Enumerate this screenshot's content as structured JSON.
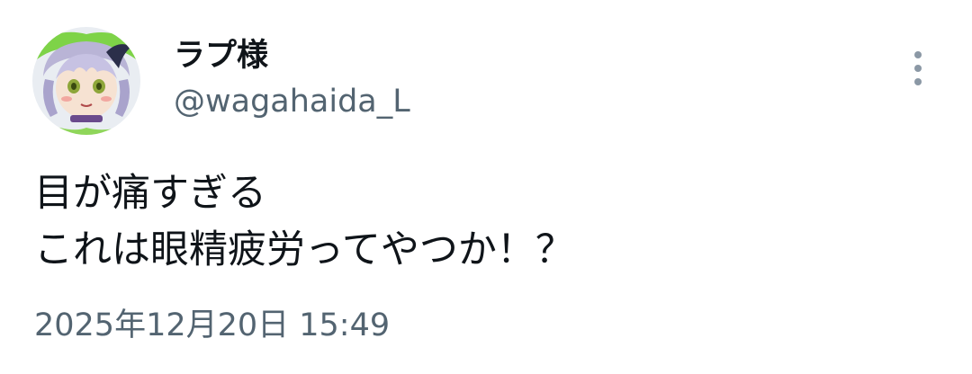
{
  "author": {
    "display_name": "ラプ様",
    "handle": "@wagahaida_L",
    "avatar_icon": "avatar-image"
  },
  "menu": {
    "icon": "more-vertical-icon"
  },
  "tweet": {
    "lines": [
      "目が痛すぎる",
      "これは眼精疲労ってやつか！？"
    ],
    "timestamp": "2025年12月20日 15:49"
  },
  "colors": {
    "text_primary": "#0f1419",
    "text_secondary": "#536471",
    "icon": "#8b98a5",
    "background": "#ffffff"
  }
}
